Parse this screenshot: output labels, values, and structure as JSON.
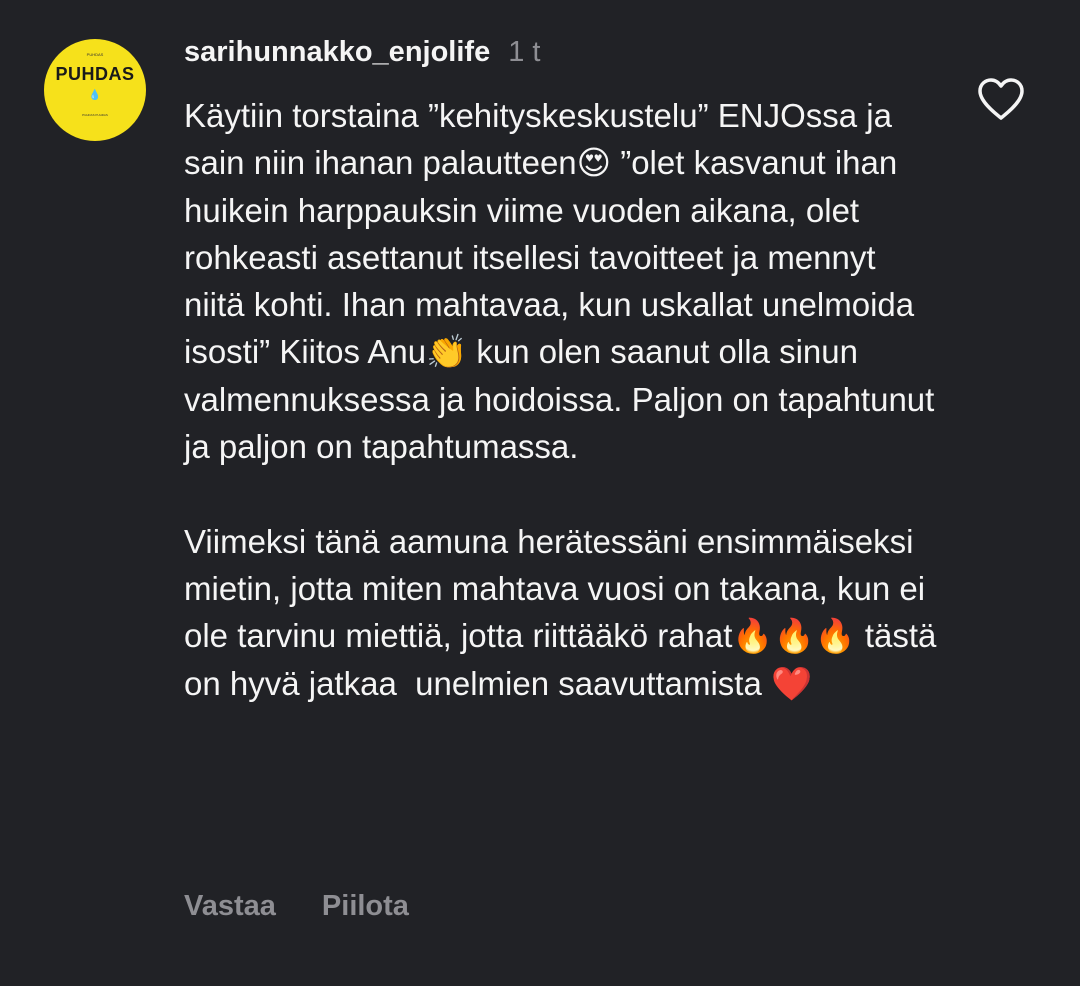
{
  "comment": {
    "avatar": {
      "top_text": "PUHDAS",
      "brand": "PUHDAS",
      "drops": "💧",
      "subtitle": "PUHDAS PUHDAS"
    },
    "username": "sarihunnakko_enjolife",
    "timestamp": "1 t",
    "like_icon": "heart-outline-icon",
    "body": "Käytiin torstaina ”kehityskeskustelu” ENJOssa ja sain niin ihanan palautteen😍 ”olet kasvanut ihan huikein harppauksin viime vuoden aikana, olet rohkeasti asettanut itsellesi tavoitteet ja mennyt niitä kohti. Ihan mahtavaa, kun uskallat unelmoida isosti” Kiitos Anu👏 kun olen saanut olla sinun valmennuksessa ja hoidoissa. Paljon on tapahtunut ja paljon on tapahtumassa.\n\nViimeksi tänä aamuna herätessäni ensimmäiseksi mietin, jotta miten mahtava vuosi on takana, kun ei ole tarvinu miettiä, jotta riittääkö rahat🔥🔥🔥 tästä on hyvä jatkaa  unelmien saavuttamista ❤️",
    "actions": {
      "reply": "Vastaa",
      "hide": "Piilota"
    }
  },
  "colors": {
    "background": "#212226",
    "text": "#f5f5f5",
    "muted": "#8e8e93",
    "avatar_bg": "#f6e11b"
  }
}
